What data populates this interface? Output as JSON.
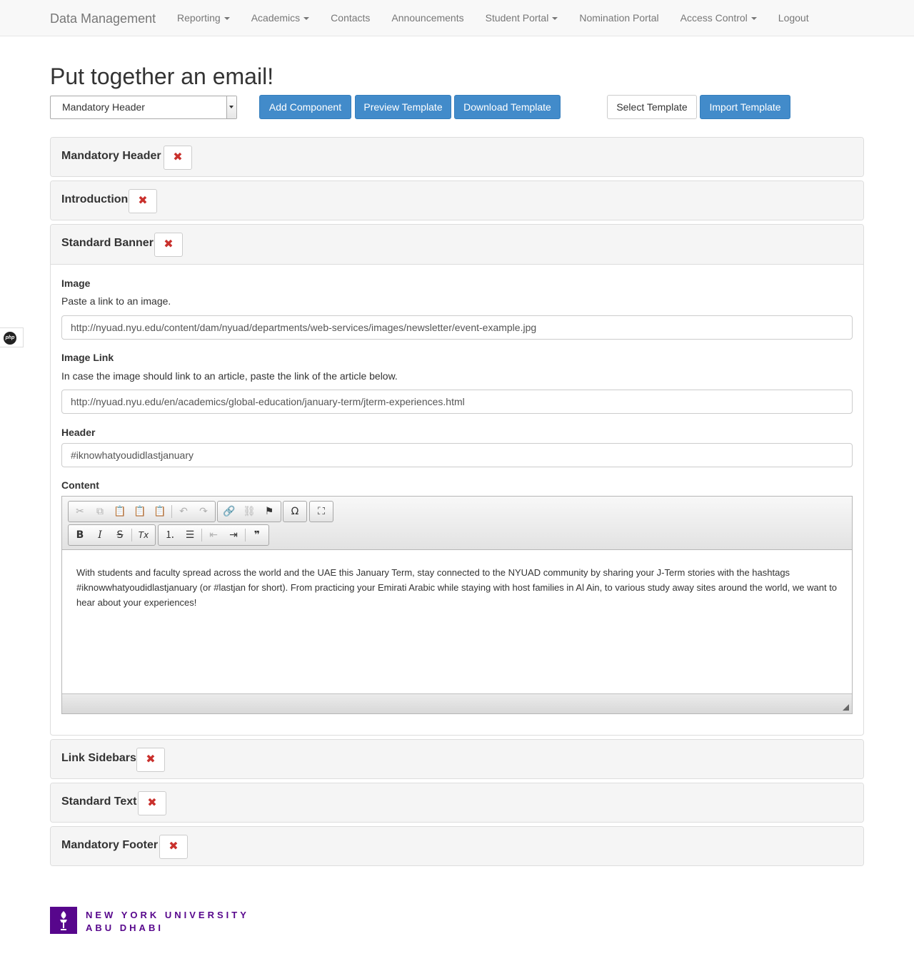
{
  "navbar": {
    "brand": "Data Management",
    "items": [
      {
        "label": "Reporting",
        "dropdown": true
      },
      {
        "label": "Academics",
        "dropdown": true
      },
      {
        "label": "Contacts",
        "dropdown": false
      },
      {
        "label": "Announcements",
        "dropdown": false
      },
      {
        "label": "Student Portal",
        "dropdown": true
      },
      {
        "label": "Nomination Portal",
        "dropdown": false
      },
      {
        "label": "Access Control",
        "dropdown": true
      },
      {
        "label": "Logout",
        "dropdown": false
      }
    ]
  },
  "page": {
    "title": "Put together an email!"
  },
  "toolbar": {
    "component_select_value": "Mandatory Header",
    "add_component": "Add Component",
    "preview_template": "Preview Template",
    "download_template": "Download Template",
    "select_template": "Select Template",
    "import_template": "Import Template"
  },
  "components": {
    "mandatory_header": "Mandatory Header",
    "introduction": "Introduction",
    "standard_banner": "Standard Banner",
    "link_sidebars": "Link Sidebars",
    "standard_text": "Standard Text",
    "mandatory_footer": "Mandatory Footer",
    "remove_glyph": "✖"
  },
  "banner": {
    "image_label": "Image",
    "image_help": "Paste a link to an image.",
    "image_value": "http://nyuad.nyu.edu/content/dam/nyuad/departments/web-services/images/newsletter/event-example.jpg",
    "image_link_label": "Image Link",
    "image_link_help": "In case the image should link to an article, paste the link of the article below.",
    "image_link_value": "http://nyuad.nyu.edu/en/academics/global-education/january-term/jterm-experiences.html",
    "header_label": "Header",
    "header_value": "#iknowhatyoudidlastjanuary",
    "content_label": "Content",
    "content_text": "With students and faculty spread across the world and the UAE this January Term, stay connected to the NYUAD community by sharing your J-Term stories with the hashtags #iknowwhatyoudidlastjanuary (or #lastjan for short). From practicing your Emirati Arabic while staying with host families in Al Ain, to various study away sites around the world, we want to hear about your experiences!"
  },
  "editor_icons": {
    "cut": "cut-icon",
    "copy": "copy-icon",
    "paste": "paste-icon",
    "paste_text": "paste-text-icon",
    "paste_word": "paste-word-icon",
    "undo": "undo-icon",
    "redo": "redo-icon",
    "link": "link-icon",
    "unlink": "unlink-icon",
    "anchor": "anchor-flag-icon",
    "special_char": "omega-icon",
    "maximize": "maximize-icon",
    "bold": "B",
    "italic": "I",
    "strike": "S",
    "remove_format": "Tx",
    "numbered_list": "numbered-list-icon",
    "bulleted_list": "bulleted-list-icon",
    "outdent": "outdent-icon",
    "indent": "indent-icon",
    "blockquote": "blockquote-icon"
  },
  "misc": {
    "php_badge": "php"
  },
  "footer": {
    "logo_line1": "NEW YORK UNIVERSITY",
    "logo_line2": "ABU DHABI"
  },
  "colors": {
    "primary": "#428bca",
    "danger": "#c9302c",
    "nyu_purple": "#57068c"
  }
}
